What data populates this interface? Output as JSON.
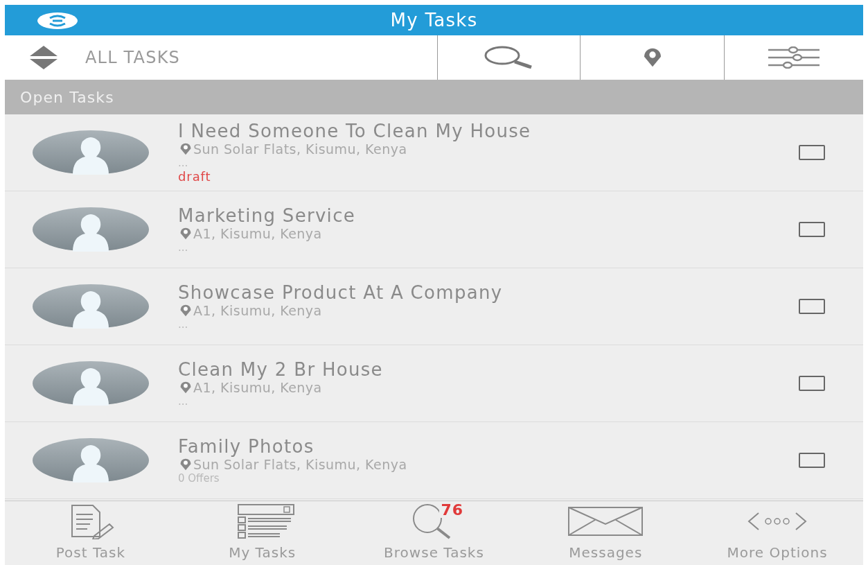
{
  "header": {
    "title": "My Tasks"
  },
  "toolbar": {
    "filter_label": "ALL TASKS"
  },
  "section": {
    "title": "Open Tasks"
  },
  "tasks": [
    {
      "title": "I Need Someone To Clean My House",
      "location": "Sun Solar Flats, Kisumu, Kenya",
      "details": "...",
      "status": "draft",
      "checked": false
    },
    {
      "title": "Marketing Service",
      "location": "A1, Kisumu, Kenya",
      "details": "...",
      "checked": false
    },
    {
      "title": "Showcase Product At A Company",
      "location": "A1, Kisumu, Kenya",
      "details": "...",
      "checked": false
    },
    {
      "title": "Clean My 2 Br House",
      "location": "A1, Kisumu, Kenya",
      "details": "...",
      "checked": false
    },
    {
      "title": "Family Photos",
      "location": "Sun Solar Flats, Kisumu, Kenya",
      "details": "0 Offers",
      "checked": false
    }
  ],
  "bottom_nav": [
    {
      "kind": "post",
      "label": "Post Task"
    },
    {
      "kind": "mytasks",
      "label": "My Tasks"
    },
    {
      "kind": "browse",
      "label": "Browse Tasks",
      "badge": "76"
    },
    {
      "kind": "messages",
      "label": "Messages"
    },
    {
      "kind": "more",
      "label": "More Options"
    }
  ]
}
